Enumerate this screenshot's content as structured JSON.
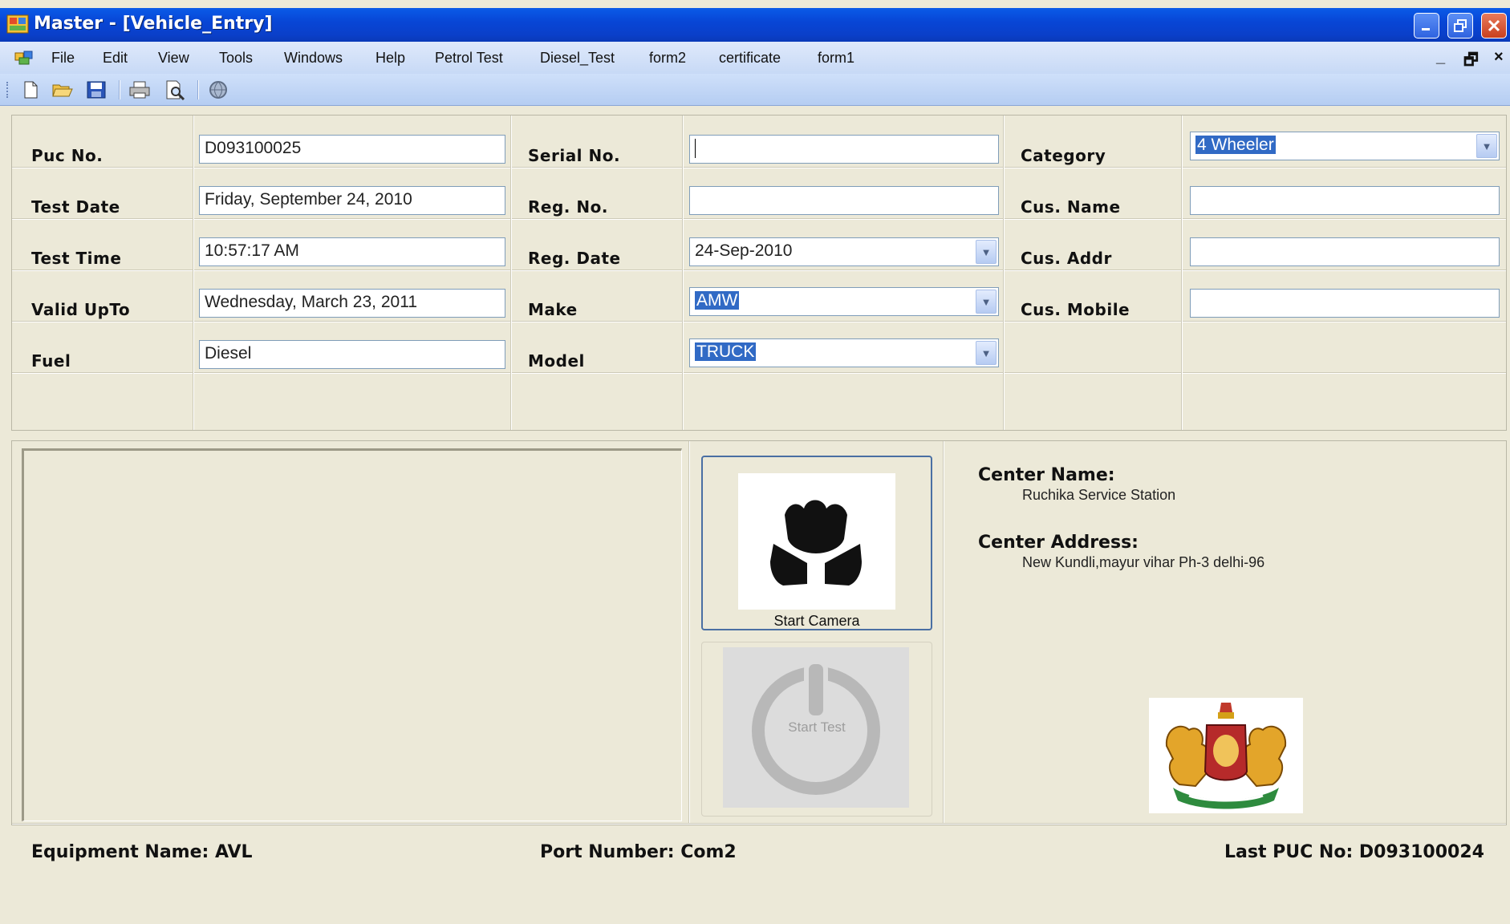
{
  "window": {
    "title": "Master - [Vehicle_Entry]"
  },
  "menu": {
    "items": [
      "File",
      "Edit",
      "View",
      "Tools",
      "Windows",
      "Help",
      "Petrol Test",
      "Diesel_Test",
      "form2",
      "certificate",
      "form1"
    ],
    "mdi_minimize": "_",
    "mdi_restore": "🗗",
    "mdi_close": "×"
  },
  "toolbar": {
    "icons": [
      "new-icon",
      "open-icon",
      "save-icon",
      "print-icon",
      "print-preview-icon",
      "help-globe-icon"
    ]
  },
  "form": {
    "col1": {
      "puc_no_label": "Puc No.",
      "puc_no_value": "D093100025",
      "test_date_label": "Test Date",
      "test_date_value": "Friday, September 24, 2010",
      "test_time_label": "Test Time",
      "test_time_value": "10:57:17 AM",
      "valid_upto_label": "Valid UpTo",
      "valid_upto_value": "Wednesday, March 23, 2011",
      "fuel_label": "Fuel",
      "fuel_value": "Diesel"
    },
    "col2": {
      "serial_no_label": "Serial No.",
      "serial_no_value": "",
      "reg_no_label": "Reg. No.",
      "reg_no_value": "",
      "reg_date_label": "Reg. Date",
      "reg_date_value": "24-Sep-2010",
      "make_label": "Make",
      "make_value": "AMW",
      "model_label": "Model",
      "model_value": "TRUCK"
    },
    "col3": {
      "category_label": "Category",
      "category_value": "4 Wheeler",
      "cus_name_label": "Cus. Name",
      "cus_name_value": "",
      "cus_addr_label": "Cus. Addr",
      "cus_addr_value": "",
      "cus_mobile_label": "Cus. Mobile",
      "cus_mobile_value": ""
    }
  },
  "buttons": {
    "start_camera": "Start Camera",
    "start_test": "Start Test"
  },
  "center": {
    "name_label": "Center Name:",
    "name_value": "Ruchika Service Station",
    "address_label": "Center Address:",
    "address_value": "New Kundli,mayur vihar Ph-3 delhi-96"
  },
  "status": {
    "equipment": "Equipment Name: AVL",
    "port": "Port Number: Com2",
    "last_puc": "Last PUC No: D093100024"
  },
  "colors": {
    "titlebar": "#0846d6",
    "selection": "#316ac5",
    "background": "#ece9d8"
  }
}
